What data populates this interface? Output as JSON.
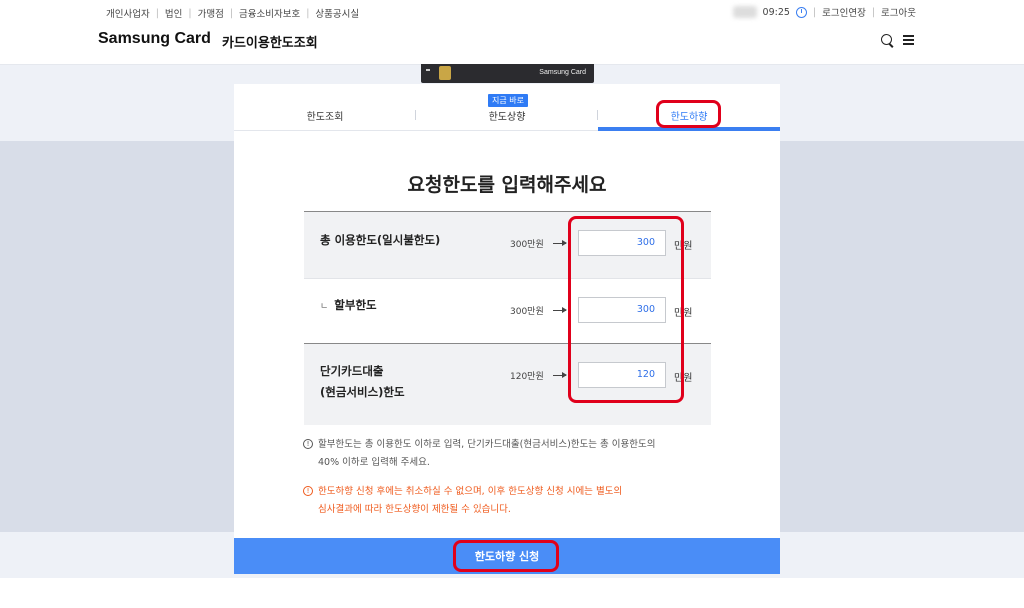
{
  "util_nav": {
    "left": [
      "개인사업자",
      "법인",
      "가맹점",
      "금융소비자보호",
      "상품공시실"
    ],
    "time": "09:25",
    "extend_login": "로그인연장",
    "logout": "로그아웃"
  },
  "header": {
    "brand": "Samsung Card",
    "title": "카드이용한도조회"
  },
  "card": {
    "logo": "Samsung Card"
  },
  "tabs": [
    {
      "label": "한도조회"
    },
    {
      "label": "한도상향",
      "badge": "지금 바로"
    },
    {
      "label": "한도하향",
      "active": true
    }
  ],
  "form": {
    "heading": "요청한도를 입력해주세요",
    "rows": [
      {
        "label": "총 이용한도(일시불한도)",
        "current": "300만원",
        "value": "300",
        "unit": "만원"
      },
      {
        "prefix": "ㄴ",
        "label": "할부한도",
        "current": "300만원",
        "value": "300",
        "unit": "만원"
      },
      {
        "label_line1": "단기카드대출",
        "label_line2": "(현금서비스)한도",
        "current": "120만원",
        "value": "120",
        "unit": "만원"
      }
    ],
    "note_gray_line1": "할부한도는 총 이용한도 이하로 입력, 단기카드대출(현금서비스)한도는 총 이용한도의",
    "note_gray_line2": "40% 이하로 입력해 주세요.",
    "note_orange_line1": "한도하향 신청 후에는 취소하실 수 없으며, 이후 한도상향 신청 시에는 별도의",
    "note_orange_line2": "심사결과에 따라 한도상향이 제한될 수 있습니다.",
    "note_icon": "!"
  },
  "submit": {
    "label": "한도하향 신청"
  },
  "colors": {
    "accent": "#3b7ff1",
    "highlight": "#e0001b",
    "warning": "#ef5a1c"
  }
}
